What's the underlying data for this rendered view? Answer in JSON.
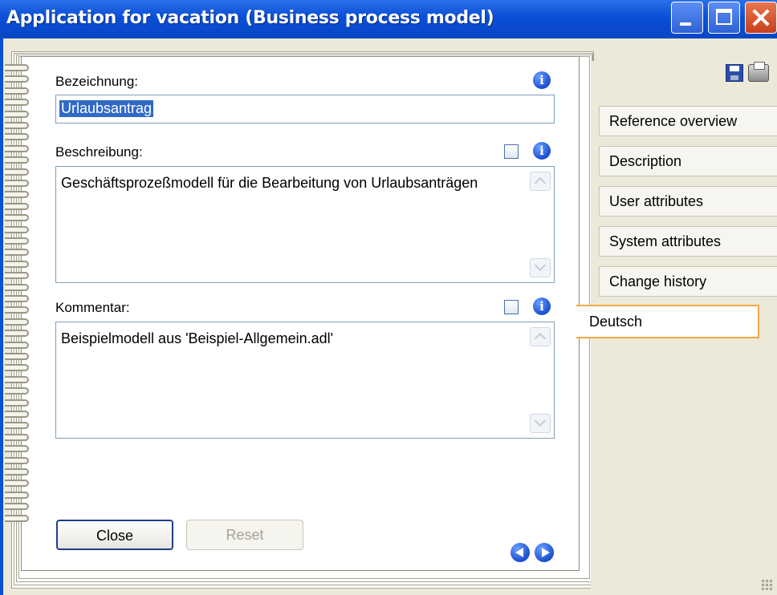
{
  "window": {
    "title": "Application for vacation (Business process model)"
  },
  "form": {
    "bezeichnung_label": "Bezeichnung:",
    "bezeichnung_value": "Urlaubsantrag",
    "beschreibung_label": "Beschreibung:",
    "beschreibung_value": "Geschäftsprozeßmodell für die Bearbeitung von Urlaubsanträgen",
    "kommentar_label": "Kommentar:",
    "kommentar_value": "Beispielmodell aus 'Beispiel-Allgemein.adl'",
    "info_glyph": "i"
  },
  "buttons": {
    "close_label": "Close",
    "reset_label": "Reset"
  },
  "tabs": [
    {
      "label": "Reference overview"
    },
    {
      "label": "Description"
    },
    {
      "label": "User attributes"
    },
    {
      "label": "System attributes"
    },
    {
      "label": "Change history"
    }
  ],
  "active_tab": {
    "label": "Deutsch"
  },
  "colors": {
    "titlebar": "#0a4fd6",
    "active_tab_border": "#f0a84a",
    "selection": "#316ac5"
  },
  "icons": [
    "info-icon",
    "checkbox-icon",
    "save-icon",
    "print-icon",
    "nav-prev-icon",
    "nav-next-icon"
  ]
}
